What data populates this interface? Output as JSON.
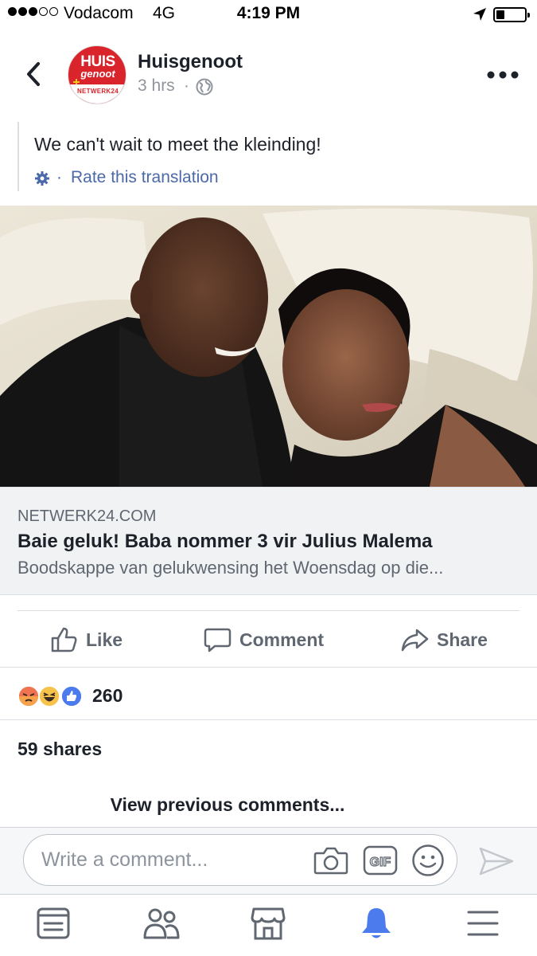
{
  "status_bar": {
    "signal_dots_filled": 3,
    "signal_dots_total": 5,
    "carrier": "Vodacom",
    "network": "4G",
    "time": "4:19 PM",
    "battery_level_fraction": 0.3
  },
  "post": {
    "page_name": "Huisgenoot",
    "avatar": {
      "logo_main": "HUIS",
      "logo_sub": "genoot",
      "logo_band": "NETWERK24"
    },
    "time_ago": "3 hrs",
    "separator": "·",
    "audience_icon": "globe-icon",
    "text": "We can't wait to meet the kleinding!",
    "rate_separator": "·",
    "rate_translation": "Rate this translation"
  },
  "link_preview": {
    "domain": "NETWERK24.COM",
    "title": "Baie geluk! Baba nommer 3 vir Julius Malema",
    "description": "Boodskappe van gelukwensing het Woensdag op die..."
  },
  "actions": {
    "like": "Like",
    "comment": "Comment",
    "share": "Share"
  },
  "reactions": {
    "types": [
      "angry",
      "haha",
      "like"
    ],
    "count": "260"
  },
  "shares": "59 shares",
  "view_previous": "View previous comments...",
  "composer": {
    "placeholder": "Write a comment..."
  },
  "tabs": [
    "news-feed-icon",
    "friends-icon",
    "marketplace-icon",
    "notifications-icon",
    "menu-icon"
  ],
  "colors": {
    "facebook_blue": "#4267b2",
    "active_tab": "#4b7bec",
    "text_primary": "#1d2129",
    "text_secondary": "#606770",
    "brand_red": "#d9242c"
  }
}
